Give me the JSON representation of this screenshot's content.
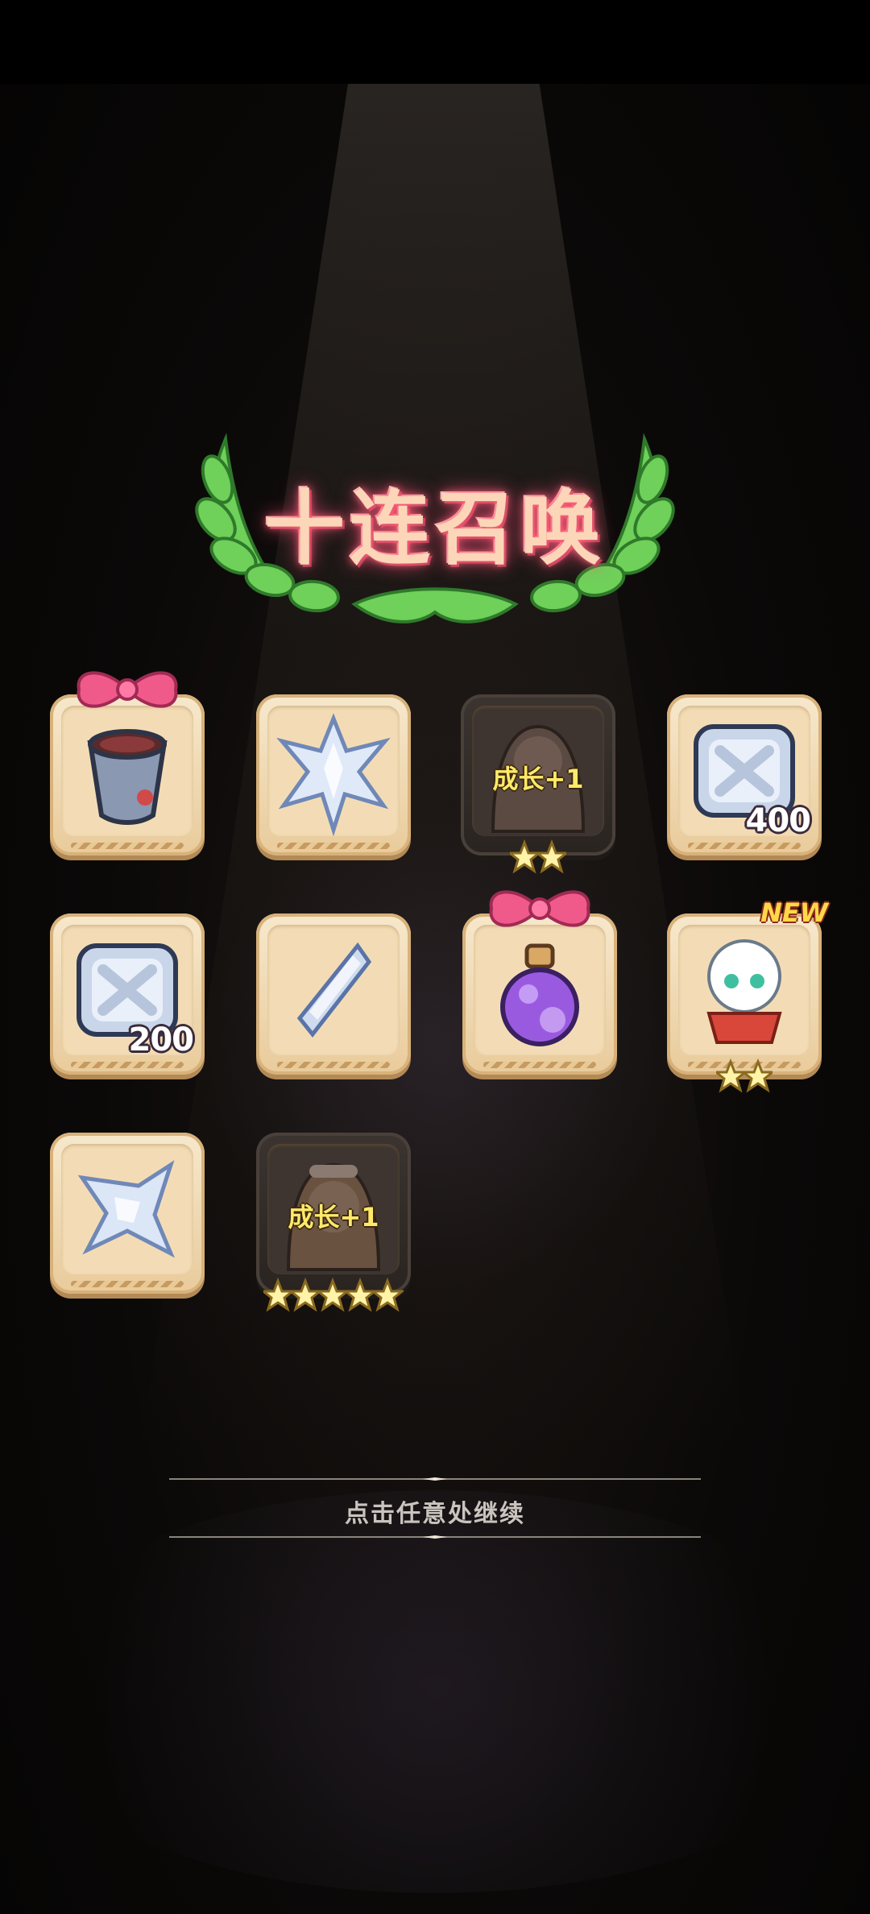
{
  "title": "十连召唤",
  "rewards": [
    {
      "id": "gift-cup",
      "qty": "",
      "stars": 0,
      "gift": true
    },
    {
      "id": "crystal-star",
      "qty": "",
      "stars": 0
    },
    {
      "id": "growth-green",
      "growth": "成长+1",
      "stars": 2,
      "glow": "green"
    },
    {
      "id": "ticket-400",
      "qty": "400",
      "stars": 0
    },
    {
      "id": "ticket-200",
      "qty": "200",
      "stars": 0
    },
    {
      "id": "crystal-shard",
      "qty": "",
      "stars": 0
    },
    {
      "id": "potion",
      "qty": "",
      "stars": 0,
      "gift": true
    },
    {
      "id": "snowman-hero",
      "qty": "",
      "stars": 2,
      "badge": "NEW"
    },
    {
      "id": "crystal-shuriken",
      "qty": "",
      "stars": 0
    },
    {
      "id": "growth-orange",
      "growth": "成长+1",
      "stars": 5,
      "glow": "orange"
    }
  ],
  "prompt": "点击任意处继续",
  "colors": {
    "card": "#f3dcb5",
    "glow_green": "#50ff3c",
    "glow_orange": "#ff8c28",
    "title": "#fcd6b8"
  }
}
